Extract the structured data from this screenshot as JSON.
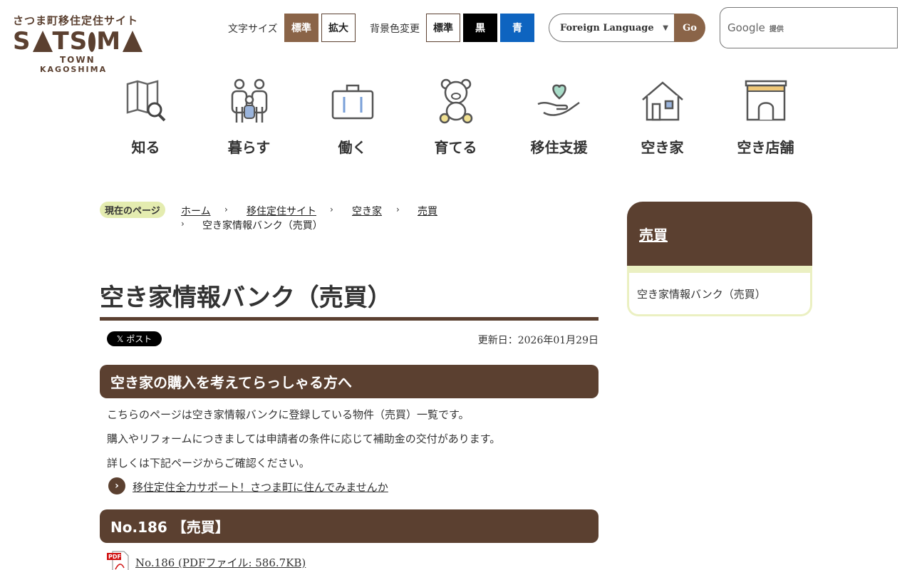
{
  "header": {
    "logo": {
      "sub": "さつま町移住定住サイト",
      "main_a": "S",
      "main_b": "TS",
      "main_c": "M",
      "town": "TOWN",
      "kagoshima": "KAGOSHIMA"
    },
    "text_size_label": "文字サイズ",
    "text_size_standard": "標準",
    "text_size_large": "拡大",
    "bg_color_label": "背景色変更",
    "bg_standard": "標準",
    "bg_black": "黒",
    "bg_blue": "青",
    "language_select": "Foreign Language",
    "go_label": "Go",
    "search_google": "Google",
    "search_provided": "提供"
  },
  "nav": [
    {
      "label": "知る",
      "icon": "map-search-icon"
    },
    {
      "label": "暮らす",
      "icon": "family-icon"
    },
    {
      "label": "働く",
      "icon": "briefcase-icon"
    },
    {
      "label": "育てる",
      "icon": "teddy-bear-icon"
    },
    {
      "label": "移住支援",
      "icon": "heart-hand-icon"
    },
    {
      "label": "空き家",
      "icon": "house-icon"
    },
    {
      "label": "空き店舗",
      "icon": "shop-icon"
    }
  ],
  "breadcrumb": {
    "badge": "現在のページ",
    "items": [
      "ホーム",
      "移住定住サイト",
      "空き家",
      "売買"
    ],
    "current": "空き家情報バンク（売買）"
  },
  "main": {
    "title": "空き家情報バンク（売買）",
    "x_post": "𝕏 ポスト",
    "updated": "更新日：2026年01月29日",
    "section1_heading": "空き家の購入を考えてらっしゃる方へ",
    "para1": "こちらのページは空き家情報バンクに登録している物件（売買）一覧です。",
    "para2": "購入やリフォームにつきましては申請者の条件に応じて補助金の交付があります。",
    "para3": "詳しくは下記ページからご確認ください。",
    "support_link": "移住定住全力サポート！さつま町に住んでみませんか",
    "section2_heading": "No.186 【売買】",
    "pdf_link": "No.186 (PDFファイル: 586.7KB)"
  },
  "side": {
    "heading": "売買",
    "item": "空き家情報バンク（売買）"
  },
  "colors": {
    "brand_brown": "#5b4030",
    "accent_brown": "#8a6448",
    "breadcrumb_badge": "#e4ecb0",
    "side_border": "#ebf0c2",
    "bg_blue": "#0e64c0"
  }
}
